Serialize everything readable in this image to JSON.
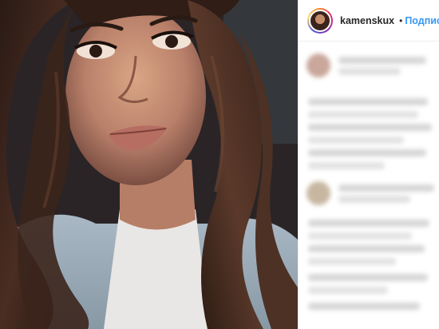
{
  "post": {
    "username": "kamenskux",
    "follow_label": "Подписа",
    "separator": "•"
  },
  "colors": {
    "follow": "#3897f0",
    "verified": "#3897f0",
    "text": "#262626",
    "blurred_text": "#d6d6d6"
  },
  "icons": {
    "verified": "verified-badge-icon",
    "avatar": "profile-avatar"
  }
}
